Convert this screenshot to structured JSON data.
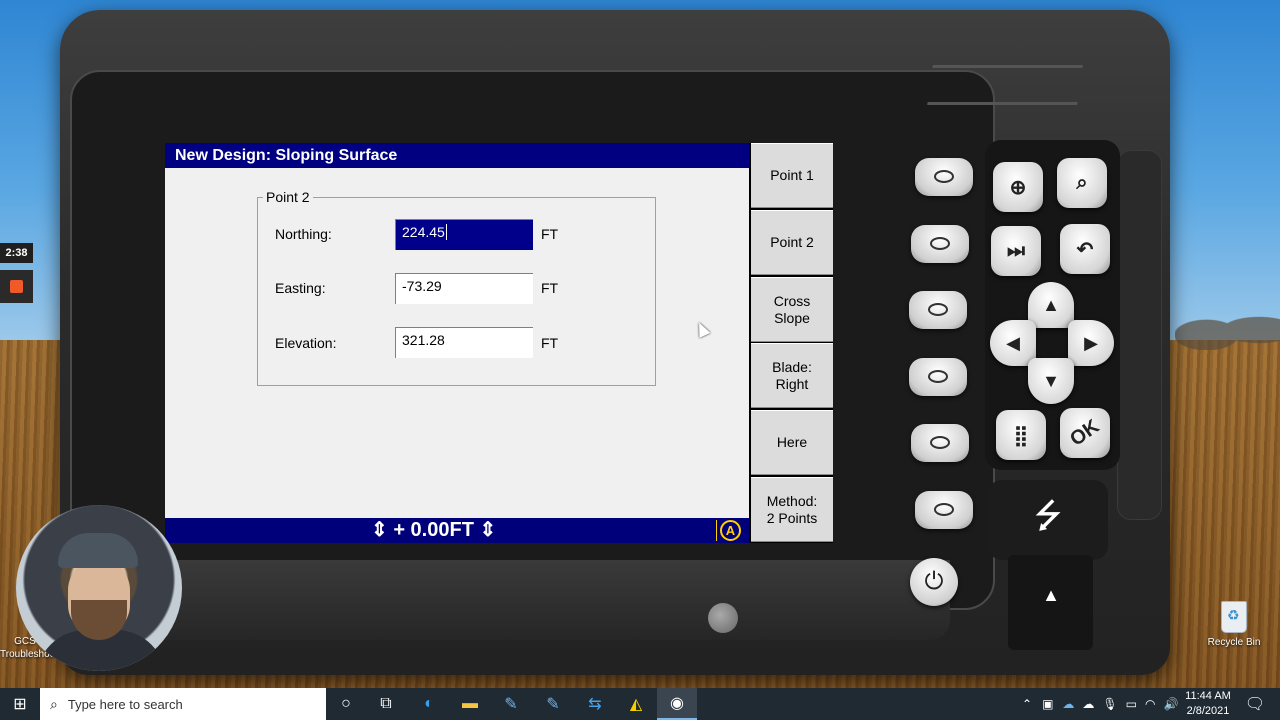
{
  "screen": {
    "title": "New Design: Sloping Surface",
    "group_title": "Point 2",
    "fields": [
      {
        "label": "Northing:",
        "value": "224.45",
        "unit": "FT"
      },
      {
        "label": "Easting:",
        "value": "-73.29",
        "unit": "FT"
      },
      {
        "label": "Elevation:",
        "value": "321.28",
        "unit": "FT"
      }
    ],
    "status": "⇕ + 0.00FT ⇕",
    "mode_badge": "A"
  },
  "softkeys": [
    {
      "label": "Point 1"
    },
    {
      "label": "Point 2"
    },
    {
      "label": "Cross\nSlope"
    },
    {
      "label": "Blade:\nRight"
    },
    {
      "label": "Here"
    },
    {
      "label": "Method:\n2 Points"
    }
  ],
  "keypad": {
    "ok_label": "OK"
  },
  "recording": {
    "timer": "2:38"
  },
  "desktop": {
    "left_icon_label": "GCS\nTroubleshoo",
    "recycle_label": "Recycle Bin"
  },
  "taskbar": {
    "search_placeholder": "Type here to search",
    "time": "11:44 AM",
    "date": "2/8/2021"
  }
}
